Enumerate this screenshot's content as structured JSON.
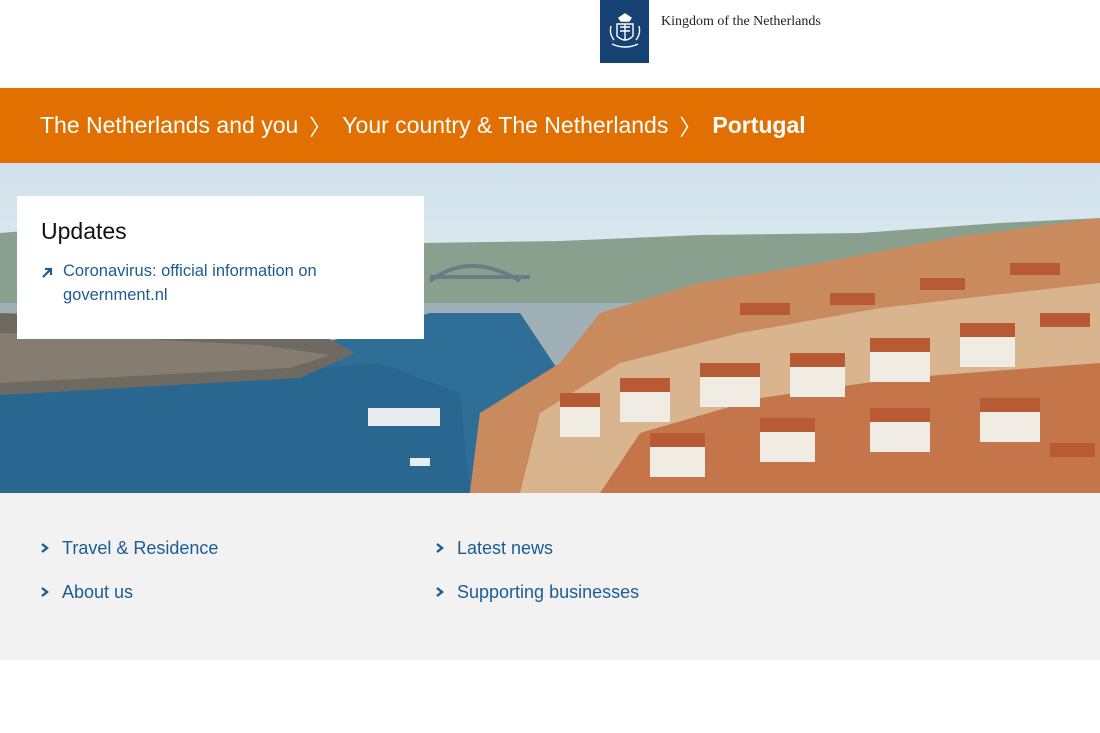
{
  "header": {
    "org_name": "Kingdom of the Netherlands",
    "logo_icon": "coat-of-arms-icon",
    "brand_color": "#154273"
  },
  "breadcrumb": {
    "items": [
      "The Netherlands and you",
      "Your country & The Netherlands"
    ],
    "current": "Portugal",
    "bar_color": "#e17000"
  },
  "hero": {
    "image_description_icon": "porto-river-photo"
  },
  "updates": {
    "title": "Updates",
    "links": [
      {
        "line1": "Coronavirus: official information on",
        "line2": "government.nl"
      }
    ]
  },
  "nav_links": {
    "col1": [
      "Travel & Residence",
      "About us"
    ],
    "col2": [
      "Latest news",
      "Supporting businesses"
    ],
    "link_color": "#1c5c93"
  }
}
